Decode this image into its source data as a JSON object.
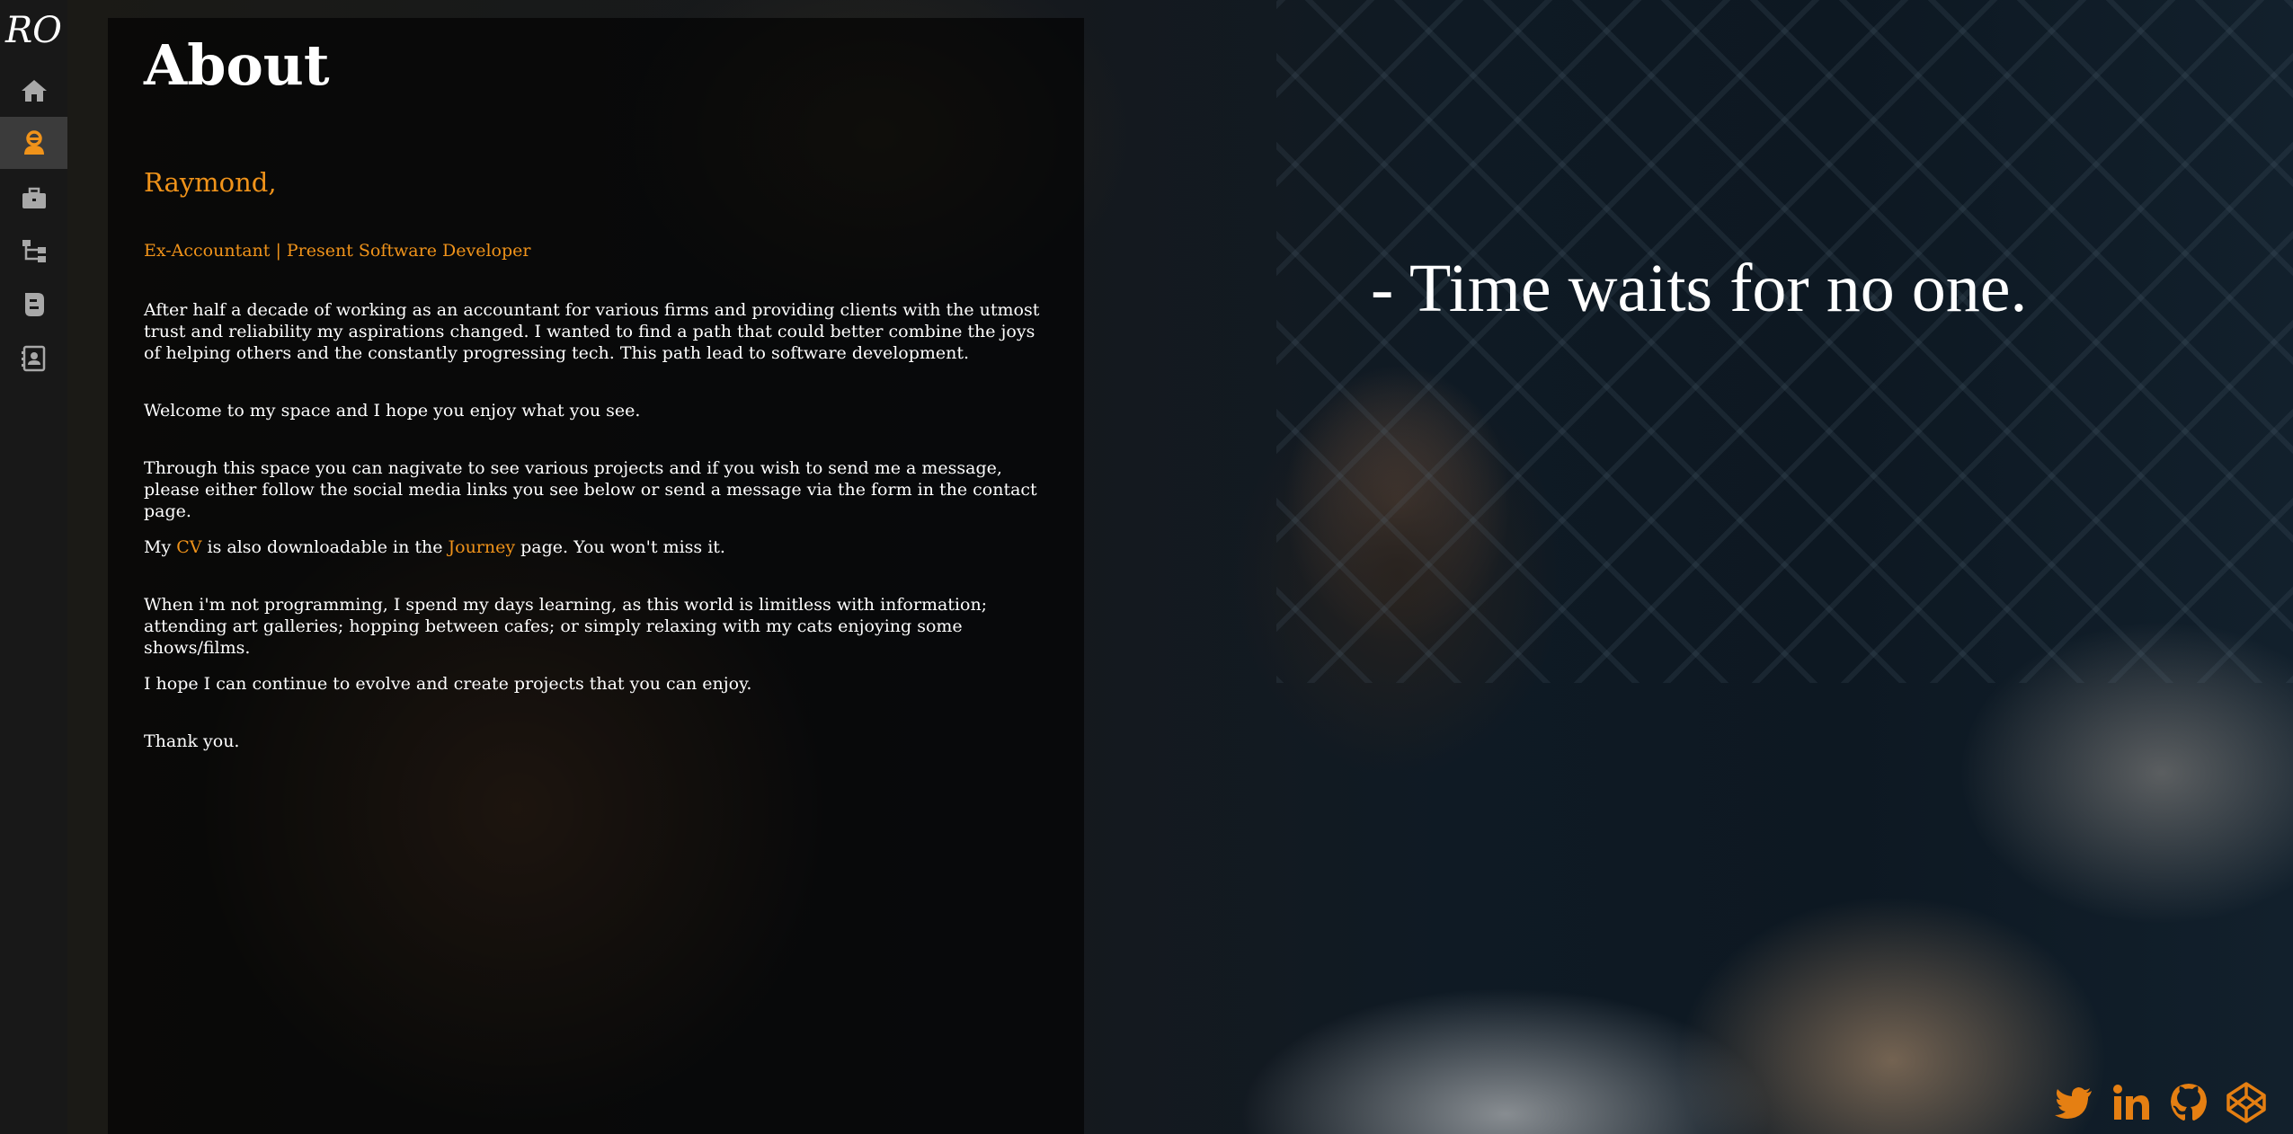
{
  "brand": {
    "logo_text": "RO"
  },
  "sidebar": {
    "items": [
      {
        "icon": "home-icon",
        "label": "Home"
      },
      {
        "icon": "user-icon",
        "label": "About",
        "active": true
      },
      {
        "icon": "briefcase-icon",
        "label": "Work"
      },
      {
        "icon": "sitemap-icon",
        "label": "Journey"
      },
      {
        "icon": "blog-icon",
        "label": "Blog"
      },
      {
        "icon": "contact-book-icon",
        "label": "Contact"
      }
    ]
  },
  "about": {
    "title": "About",
    "greeting": "Raymond,",
    "tagline": "Ex-Accountant | Present Software Developer",
    "p1": "After half a decade of working as an accountant for various firms and providing clients with the utmost trust and reliability my aspirations changed. I wanted to find a path that could better combine the joys of helping others and the constantly progressing tech. This path lead to software development.",
    "p2": "Welcome to my space and I hope you enjoy what you see.",
    "p3": "Through this space you can nagivate to see various projects and if you wish to send me a message, please either follow the social media links you see below or send a message via the form in the contact page.",
    "p4": {
      "before": "My ",
      "cv_link": "CV",
      "middle": " is also downloadable in the ",
      "journey_link": "Journey",
      "after": " page. You won't miss it."
    },
    "p5": "When i'm not programming, I spend my days learning, as this world is limitless with information; attending art galleries; hopping between cafes; or simply relaxing with my cats enjoying some shows/films.",
    "p6": "I hope I can continue to evolve and create projects that you can enjoy.",
    "p7": "Thank you."
  },
  "quote": "- Time waits for no one.",
  "socials": [
    "twitter-icon",
    "linkedin-icon",
    "github-icon",
    "codepen-icon"
  ],
  "colors": {
    "accent": "#f0931a",
    "sidebar_bg": "#181818",
    "active_bg": "#3b3b3b",
    "icon_gray": "#a8a8a8"
  }
}
